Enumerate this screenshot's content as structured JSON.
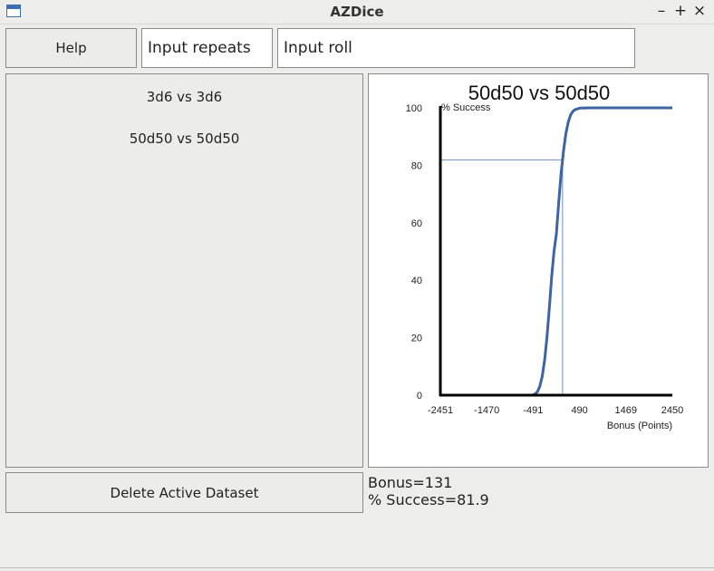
{
  "window": {
    "title": "AZDice",
    "minimize": "–",
    "maximize": "+",
    "close": "×",
    "app_icon": "window-app-icon"
  },
  "toolbar": {
    "help_label": "Help",
    "repeats_placeholder": "Input repeats",
    "roll_placeholder": "Input roll"
  },
  "datasets": {
    "items": [
      "3d6 vs 3d6",
      "50d50 vs 50d50"
    ]
  },
  "actions": {
    "delete_label": "Delete Active Dataset"
  },
  "readout": {
    "bonus": "Bonus=131",
    "success": "% Success=81.9"
  },
  "colors": {
    "curve": "#3e64a3",
    "marker": "#6e90c2",
    "axis": "#000000"
  },
  "chart_data": {
    "type": "line",
    "title": "50d50 vs 50d50",
    "ylabel": "% Success",
    "xlabel": "Bonus (Points)",
    "xlim": [
      -2451,
      2450
    ],
    "ylim": [
      0,
      100
    ],
    "xticks": [
      "-2451",
      "-1470",
      "-491",
      "490",
      "1469",
      "2450"
    ],
    "yticks": [
      "0",
      "20",
      "40",
      "60",
      "80",
      "100"
    ],
    "series": [
      {
        "x": [
          -2451,
          -500,
          -450,
          -400,
          -350,
          -300,
          -250,
          -200,
          -150,
          -100,
          -50,
          0,
          50,
          100,
          131,
          150,
          200,
          250,
          300,
          350,
          400,
          450,
          500,
          700,
          1000,
          2450
        ],
        "y": [
          0,
          0,
          0.4,
          1.2,
          3,
          6.5,
          12,
          20,
          30,
          41,
          50,
          56,
          67,
          77,
          81.9,
          85,
          91,
          95,
          97.5,
          98.8,
          99.4,
          99.7,
          99.9,
          100,
          100,
          100
        ]
      }
    ],
    "marker": {
      "x": 131,
      "y": 81.9
    },
    "grid": false,
    "legend": "none"
  }
}
